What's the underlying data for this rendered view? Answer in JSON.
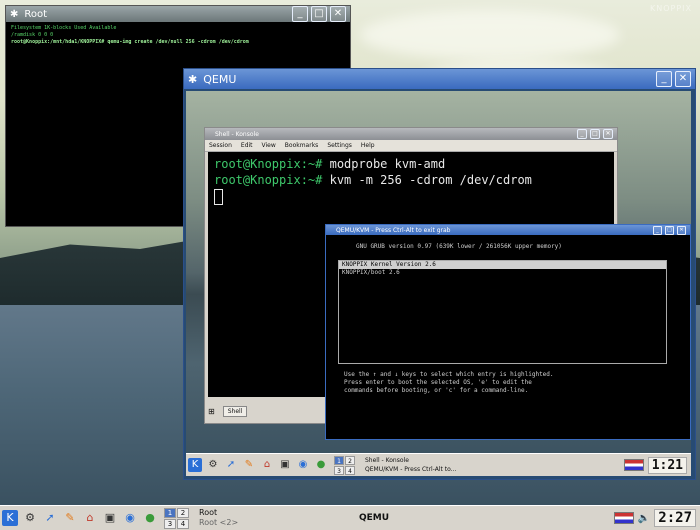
{
  "watermark": "KNOPPIX",
  "root_window": {
    "title": "Root",
    "lines": [
      "Filesystem   1K-blocks   Used  Available",
      "/ramdisk            0         0          0",
      "root@Knoppix:/mnt/hda1/KNOPPIX# qemu-img create /dev/null 256 -cdrom /dev/cdrom"
    ]
  },
  "qemu_window": {
    "title": "QEMU"
  },
  "konsole": {
    "title": "Shell - Konsole",
    "menu": [
      "Session",
      "Edit",
      "View",
      "Bookmarks",
      "Settings",
      "Help"
    ],
    "prompt": "root@Knoppix:~#",
    "cmd1": " modprobe kvm-amd",
    "cmd2": " kvm -m 256 -cdrom /dev/cdrom",
    "tab": "Shell"
  },
  "guest": {
    "title": "QEMU/KVM - Press Ctrl-Alt to exit grab",
    "grub_header": "GNU GRUB  version 0.97  (639K lower / 261056K upper memory)",
    "entries": [
      "KNOPPIX Kernel Version 2.6",
      "KNOPPIX/boot 2.6"
    ],
    "help": [
      "Use the ↑ and ↓ keys to select which entry is highlighted.",
      "Press enter to boot the selected OS, 'e' to edit the",
      "commands before booting, or 'c' for a command-line."
    ]
  },
  "qemu_taskbar": {
    "pager": [
      "1",
      "2",
      "3",
      "4"
    ],
    "tasks": [
      "Shell - Konsole",
      "QEMU/KVM - Press Ctrl-Alt to..."
    ],
    "clock": "1:21"
  },
  "taskbar": {
    "pager": [
      "1",
      "2",
      "3",
      "4"
    ],
    "tasks": [
      "Root",
      "Root <2>"
    ],
    "qemu": "QEMU",
    "clock": "2:27"
  }
}
